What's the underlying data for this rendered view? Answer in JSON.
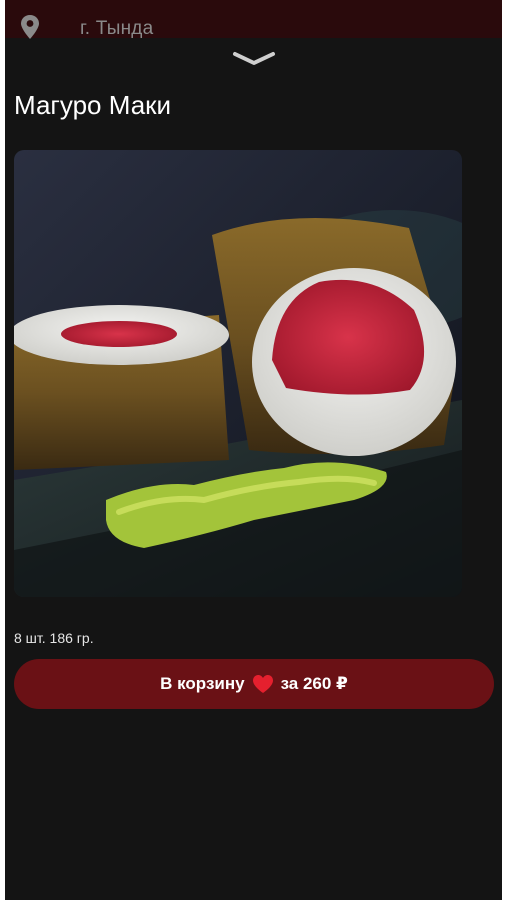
{
  "header": {
    "location_icon": "map-pin-icon",
    "city": "г. Тында",
    "collapse_icon": "chevron-down-icon"
  },
  "product": {
    "title": "Магуро Маки",
    "image_alt": "Магуро Маки",
    "meta": "8 шт. 186 гр."
  },
  "cart_button": {
    "label_before": "В корзину",
    "heart_icon": "heart-icon",
    "label_after": "за 260 ₽"
  },
  "colors": {
    "background": "#141414",
    "header": "#2a0a0c",
    "accent": "#6a1115",
    "heart": "#e5202e"
  }
}
